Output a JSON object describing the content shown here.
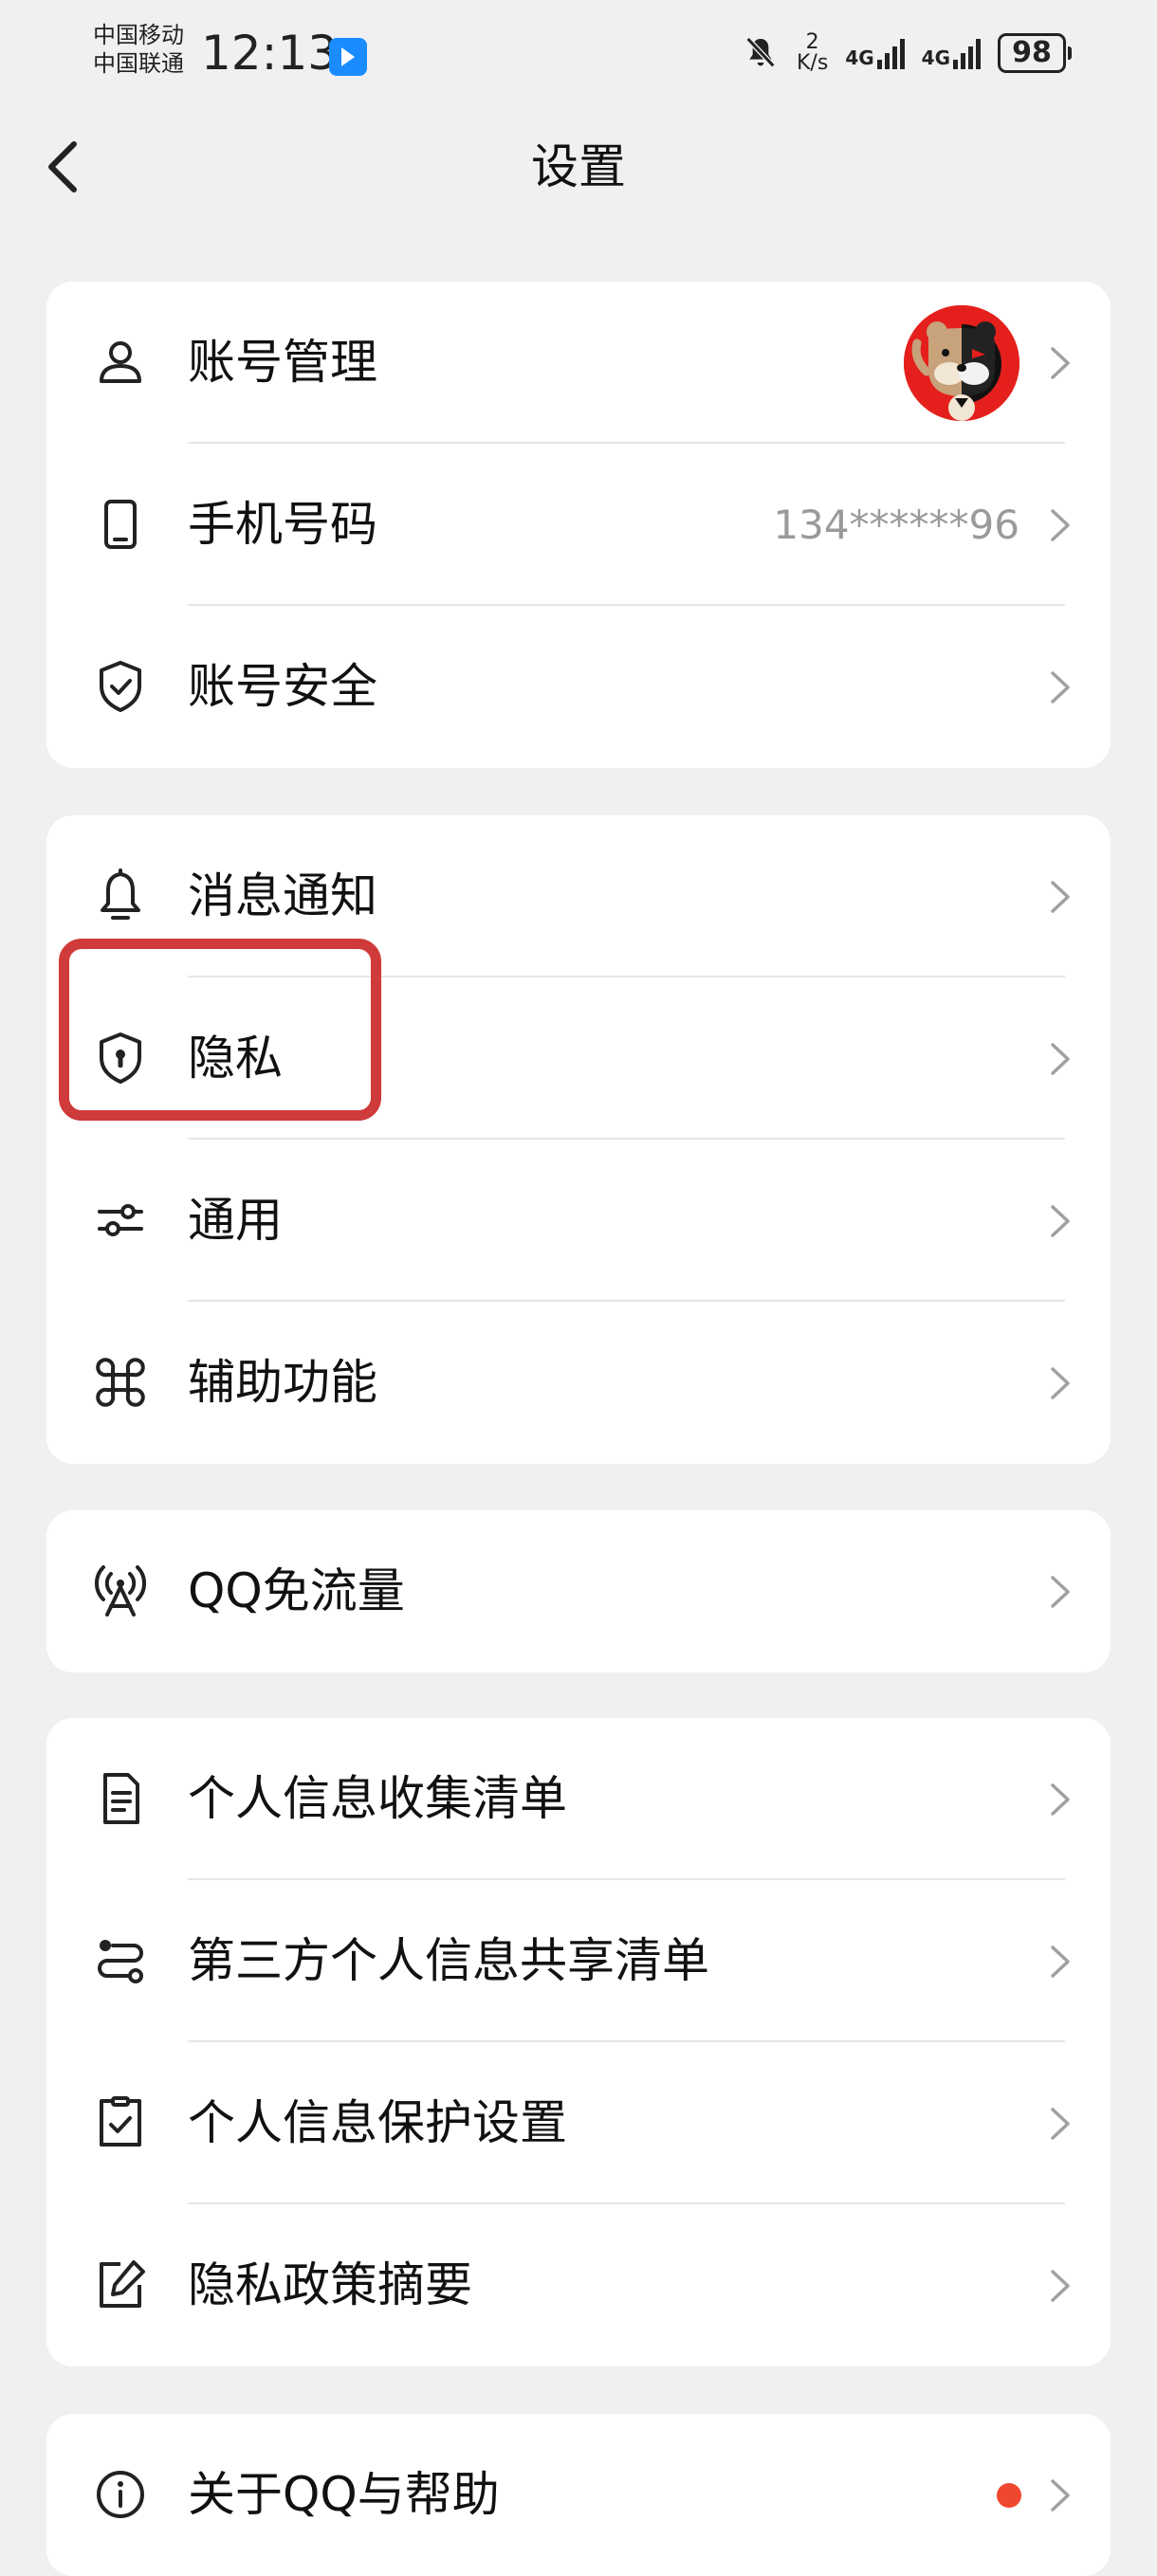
{
  "status_bar": {
    "carrier_1": "中国移动",
    "carrier_2": "中国联通",
    "time": "12:13",
    "speed_value": "2",
    "speed_unit": "K/s",
    "net_1": "4G",
    "net_2": "4G",
    "battery": "98"
  },
  "header": {
    "title": "设置",
    "back_icon": "chevron-left-icon"
  },
  "sections": [
    {
      "items": [
        {
          "label": "账号管理",
          "icon": "user-icon",
          "trailing": "avatar"
        },
        {
          "label": "手机号码",
          "icon": "phone-icon",
          "value": "134******96"
        },
        {
          "label": "账号安全",
          "icon": "shield-check-icon"
        }
      ]
    },
    {
      "items": [
        {
          "label": "消息通知",
          "icon": "bell-icon"
        },
        {
          "label": "隐私",
          "icon": "privacy-shield-icon",
          "highlighted": true
        },
        {
          "label": "通用",
          "icon": "sliders-icon"
        },
        {
          "label": "辅助功能",
          "icon": "command-icon"
        }
      ]
    },
    {
      "items": [
        {
          "label": "QQ免流量",
          "icon": "antenna-icon"
        }
      ]
    },
    {
      "items": [
        {
          "label": "个人信息收集清单",
          "icon": "document-icon"
        },
        {
          "label": "第三方个人信息共享清单",
          "icon": "share-list-icon"
        },
        {
          "label": "个人信息保护设置",
          "icon": "checkbox-icon"
        },
        {
          "label": "隐私政策摘要",
          "icon": "edit-icon"
        }
      ]
    },
    {
      "items": [
        {
          "label": "关于QQ与帮助",
          "icon": "info-icon",
          "badge": "red-dot"
        }
      ]
    }
  ],
  "colors": {
    "background": "#f0f0f2",
    "card": "#ffffff",
    "highlight_box": "#cf3a3a",
    "badge": "#f0482e"
  }
}
